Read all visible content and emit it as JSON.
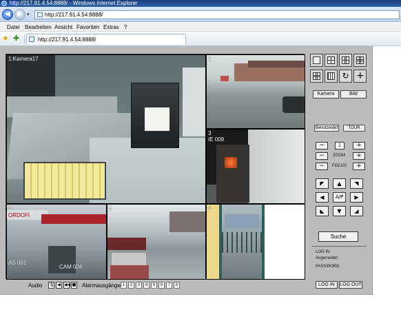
{
  "window": {
    "title": "http://217.91.4.54:8888/ - Windows Internet Explorer",
    "address": "http://217.91.4.54:8888/",
    "back_glyph": "◀",
    "forward_glyph": "▶",
    "dropdown_glyph": "▾"
  },
  "menu": [
    "Datei",
    "Bearbeiten",
    "Ansicht",
    "Favoriten",
    "Extras",
    "?"
  ],
  "favorites": {
    "star_glyph": "★",
    "add_glyph": "✚",
    "tab_title": "http://217.91.4.54:8888/"
  },
  "cameras": [
    {
      "label": "1:Kamera17"
    },
    {
      "label": "2"
    },
    {
      "label": "3",
      "overlay": "IE 009"
    },
    {
      "label": "4",
      "overlay_top": "ORDOFI",
      "overlay_bottom": "AS 001",
      "overlay_bottom2": "CAM 004"
    },
    {
      "label": "5"
    },
    {
      "label": "6"
    }
  ],
  "bottom": {
    "audio_label": "Audio",
    "audio_buttons": [
      "🎙",
      "◀",
      "◀◀",
      "■"
    ],
    "alarm_label": "Alarmausgänge",
    "alarm_outputs": [
      "1",
      "2",
      "3",
      "4",
      "5",
      "6",
      "7",
      "8"
    ],
    "login_label": "LOG IN",
    "logout_label": "LOG OUT"
  },
  "panel": {
    "layout_icons": [
      "single-view-icon",
      "quad-view-icon",
      "six-view-icon",
      "nine-view-icon",
      "twelve-view-icon",
      "sixteen-view-icon",
      "cycle-icon",
      "add-icon"
    ],
    "cycle_glyph": "↻",
    "add_glyph": "+",
    "tab_camera": "Kamera",
    "tab_image": "Bild",
    "user_button": "Benutzerdef",
    "tour_button": "TOUR",
    "speed_value": "1",
    "zoom_label": "ZOOM",
    "focus_label": "FOCUS",
    "minus_glyph": "−",
    "plus_glyph": "+",
    "ptz": {
      "up_left": "◤",
      "up": "▲",
      "up_right": "◥",
      "left": "◀",
      "center": "A/P",
      "right": "▶",
      "down_left": "◣",
      "down": "▼",
      "down_right": "◢"
    },
    "search_label": "Suche",
    "log_in_status": "LOG IN",
    "user_status": "Angemeldet",
    "password_status": "PASSWORD"
  }
}
